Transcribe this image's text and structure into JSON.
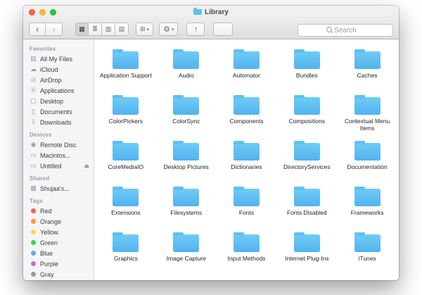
{
  "window": {
    "title": "Library"
  },
  "toolbar": {
    "search_placeholder": "Search",
    "icons": {
      "back": "‹",
      "forward": "›",
      "view_icons": "▦",
      "view_list": "≣",
      "view_columns": "▥",
      "view_coverflow": "▤",
      "arrange": "⊞",
      "gear": "⚙",
      "caret": "▾",
      "share": "↑"
    }
  },
  "icon_glyphs": {
    "all-my-files": "▤",
    "icloud": "☁",
    "airdrop": "◎",
    "applications": "Ⓐ",
    "desktop": "▢",
    "documents": "▯",
    "downloads": "⇩",
    "remote-disc": "◉",
    "hard-drive": "▭",
    "shared-computer": "▦",
    "eject": "⏏"
  },
  "sidebar": {
    "sections": [
      {
        "title": "Favorites",
        "items": [
          {
            "label": "All My Files",
            "icon": "all-my-files"
          },
          {
            "label": "iCloud",
            "icon": "icloud"
          },
          {
            "label": "AirDrop",
            "icon": "airdrop"
          },
          {
            "label": "Applications",
            "icon": "applications"
          },
          {
            "label": "Desktop",
            "icon": "desktop"
          },
          {
            "label": "Documents",
            "icon": "documents"
          },
          {
            "label": "Downloads",
            "icon": "downloads"
          }
        ]
      },
      {
        "title": "Devices",
        "items": [
          {
            "label": "Remote Disc",
            "icon": "remote-disc"
          },
          {
            "label": "Macintos...",
            "icon": "hard-drive"
          },
          {
            "label": "Untitled",
            "icon": "hard-drive",
            "eject": true
          }
        ]
      },
      {
        "title": "Shared",
        "items": [
          {
            "label": "Shujaa's...",
            "icon": "shared-computer"
          }
        ]
      },
      {
        "title": "Tags",
        "items": [
          {
            "label": "Red",
            "color": "#f95e57"
          },
          {
            "label": "Orange",
            "color": "#fd9927"
          },
          {
            "label": "Yellow",
            "color": "#fdd643"
          },
          {
            "label": "Green",
            "color": "#3fd158"
          },
          {
            "label": "Blue",
            "color": "#61a8f8"
          },
          {
            "label": "Purple",
            "color": "#c46ddc"
          },
          {
            "label": "Gray",
            "color": "#9a9a9e"
          }
        ]
      }
    ]
  },
  "folders": [
    "Application Support",
    "Audio",
    "Automator",
    "Bundles",
    "Caches",
    "ColorPickers",
    "ColorSync",
    "Components",
    "Compositions",
    "Contextual Menu Items",
    "CoreMediaIO",
    "Desktop Pictures",
    "Dictionaries",
    "DirectoryServices",
    "Documentation",
    "Extensions",
    "Filesystems",
    "Fonts",
    "Fonts Disabled",
    "Frameworks",
    "Graphics",
    "Image Capture",
    "Input Methods",
    "Internet Plug-Ins",
    "iTunes"
  ]
}
